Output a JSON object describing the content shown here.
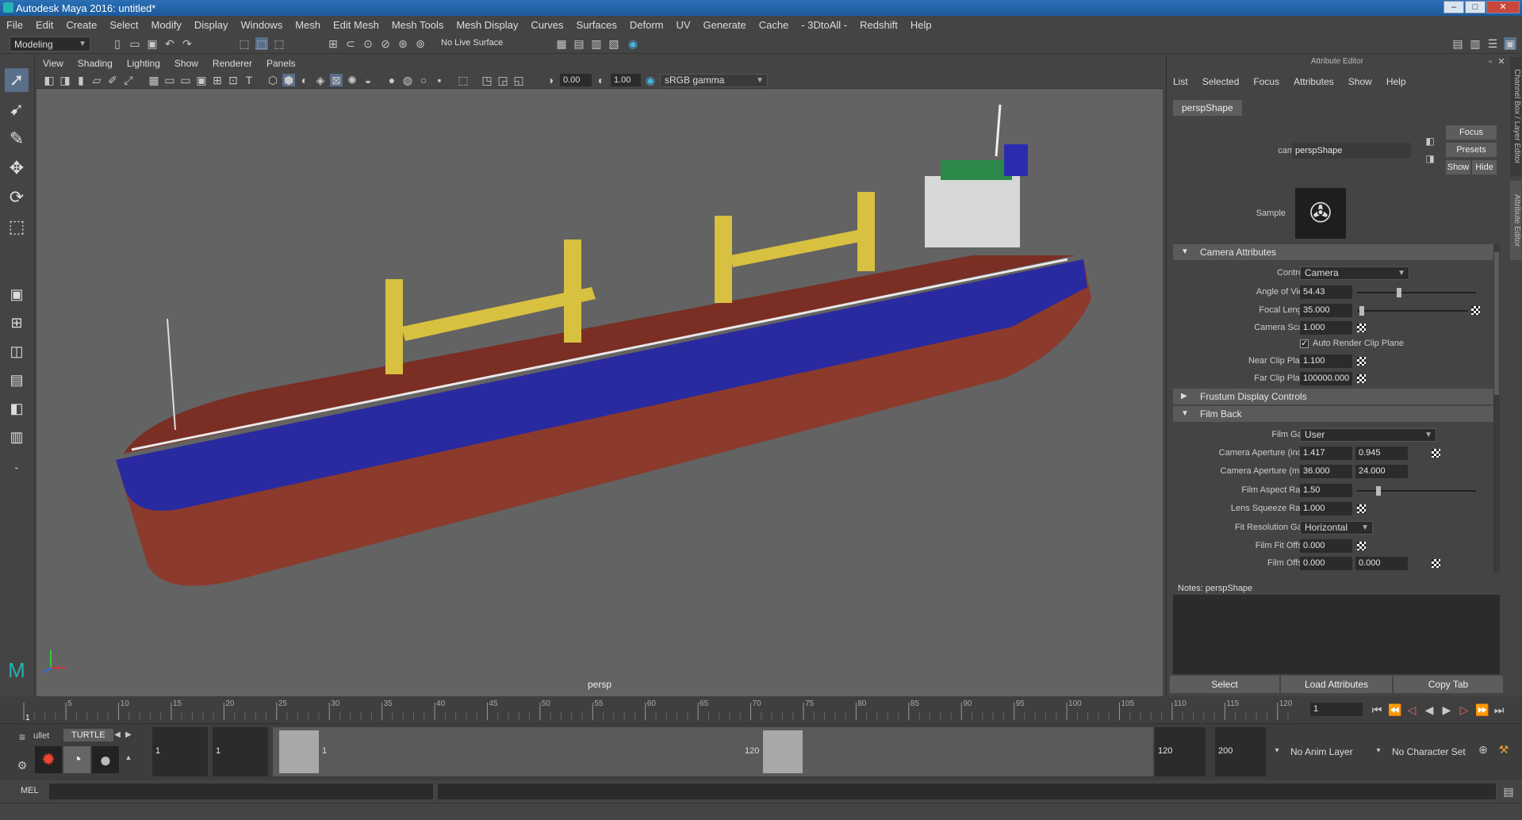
{
  "window": {
    "title": "Autodesk Maya 2016: untitled*",
    "min": "–",
    "max": "□",
    "close": "✕"
  },
  "menubar": {
    "items": [
      "File",
      "Edit",
      "Create",
      "Select",
      "Modify",
      "Display",
      "Windows",
      "Mesh",
      "Edit Mesh",
      "Mesh Tools",
      "Mesh Display",
      "Curves",
      "Surfaces",
      "Deform",
      "UV",
      "Generate",
      "Cache",
      "- 3DtoAll -",
      "Redshift",
      "Help"
    ]
  },
  "toolbar": {
    "mode": "Modeling",
    "live_surface": "No Live Surface"
  },
  "viewport": {
    "menu": [
      "View",
      "Shading",
      "Lighting",
      "Show",
      "Renderer",
      "Panels"
    ],
    "exposure": "0.00",
    "gamma": "1.00",
    "color_space": "sRGB gamma",
    "camera_label": "persp"
  },
  "attribute_editor": {
    "title": "Attribute Editor",
    "menu": [
      "List",
      "Selected",
      "Focus",
      "Attributes",
      "Show",
      "Help"
    ],
    "tab": "perspShape",
    "camera_label": "camera:",
    "camera_value": "perspShape",
    "focus": "Focus",
    "presets": "Presets",
    "show": "Show",
    "hide": "Hide",
    "sample": "Sample",
    "sections": {
      "camera_attributes": "Camera Attributes",
      "frustum": "Frustum Display Controls",
      "film_back": "Film Back"
    },
    "camera_attrs": {
      "controls_label": "Controls",
      "controls_value": "Camera",
      "aov_label": "Angle of View",
      "aov_value": "54.43",
      "focal_label": "Focal Length",
      "focal_value": "35.000",
      "scale_label": "Camera Scale",
      "scale_value": "1.000",
      "auto_clip": "Auto Render Clip Plane",
      "near_label": "Near Clip Plane",
      "near_value": "1.100",
      "far_label": "Far Clip Plane",
      "far_value": "100000.000"
    },
    "film_back": {
      "gate_label": "Film Gate",
      "gate_value": "User",
      "aperture_in_label": "Camera Aperture (inch)",
      "aperture_in_x": "1.417",
      "aperture_in_y": "0.945",
      "aperture_mm_label": "Camera Aperture (mm)",
      "aperture_mm_x": "36.000",
      "aperture_mm_y": "24.000",
      "aspect_label": "Film Aspect Ratio",
      "aspect_value": "1.50",
      "squeeze_label": "Lens Squeeze Ratio",
      "squeeze_value": "1.000",
      "fit_gate_label": "Fit Resolution Gate",
      "fit_gate_value": "Horizontal",
      "fit_offset_label": "Film Fit Offset",
      "fit_offset_value": "0.000",
      "offset_label": "Film Offset",
      "offset_x": "0.000",
      "offset_y": "0.000"
    },
    "notes_label": "Notes:  perspShape",
    "buttons": {
      "select": "Select",
      "load": "Load Attributes",
      "copy": "Copy Tab"
    },
    "side_tabs": [
      "Channel Box / Layer Editor",
      "Attribute Editor"
    ]
  },
  "timeline": {
    "ticks": [
      "1",
      "5",
      "10",
      "15",
      "20",
      "25",
      "30",
      "35",
      "40",
      "45",
      "50",
      "55",
      "60",
      "65",
      "70",
      "75",
      "80",
      "85",
      "90",
      "95",
      "100",
      "105",
      "110",
      "115",
      "120"
    ],
    "current_frame": "1"
  },
  "range": {
    "shelf_tabs": [
      "ullet",
      "TURTLE"
    ],
    "start": "1",
    "start2": "1",
    "slider_start": "1",
    "slider_end": "120",
    "end": "120",
    "end2": "200",
    "anim_layer": "No Anim Layer",
    "character_set": "No Character Set"
  },
  "cmdline": {
    "lang": "MEL"
  }
}
